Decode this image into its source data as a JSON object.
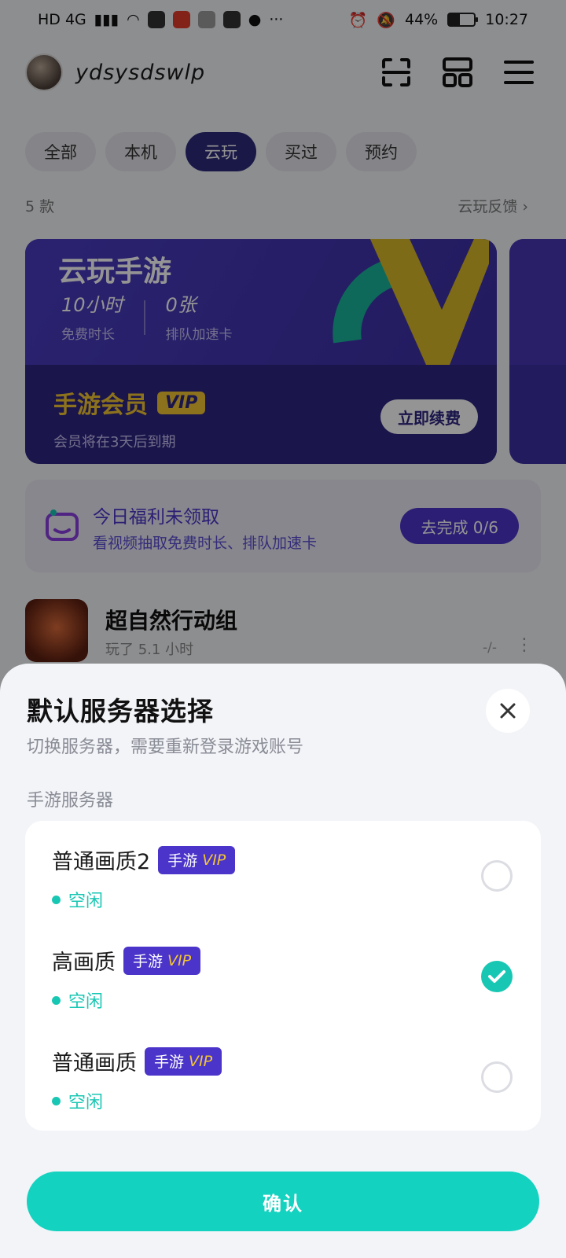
{
  "status_bar": {
    "network": "HD 4G",
    "chips": [
      "游戏大全",
      "微博",
      "QQ",
      "游戏大全"
    ],
    "more": "···",
    "battery": "44%",
    "time": "10:27"
  },
  "header": {
    "username": "ydsysdswlp"
  },
  "tabs": [
    {
      "label": "全部"
    },
    {
      "label": "本机"
    },
    {
      "label": "云玩"
    },
    {
      "label": "买过"
    },
    {
      "label": "预约"
    }
  ],
  "active_tab": "云玩",
  "list_info": {
    "count": "5 款",
    "feedback": "云玩反馈"
  },
  "banner": {
    "title": "云玩手游",
    "stat1_value": "10小时",
    "stat1_label": "免费时长",
    "stat2_value": "0张",
    "stat2_label": "排队加速卡",
    "vip_title": "手游会员",
    "vip_tag": "VIP",
    "vip_sub": "会员将在3天后到期",
    "renew_button": "立即续费"
  },
  "welfare": {
    "title": "今日福利未领取",
    "subtitle": "看视频抽取免费时长、排队加速卡",
    "button": "去完成 0/6"
  },
  "game": {
    "name": "超自然行动组",
    "played": "玩了 5.1 小时",
    "meta": "-/-"
  },
  "sheet": {
    "title": "默认服务器选择",
    "subtitle": "切换服务器，需要重新登录游戏账号",
    "section_label": "手游服务器",
    "servers": [
      {
        "name": "普通画质2",
        "badge_a": "手游",
        "badge_b": "VIP",
        "status": "空闲",
        "selected": false
      },
      {
        "name": "高画质",
        "badge_a": "手游",
        "badge_b": "VIP",
        "status": "空闲",
        "selected": true
      },
      {
        "name": "普通画质",
        "badge_a": "手游",
        "badge_b": "VIP",
        "status": "空闲",
        "selected": false
      }
    ],
    "confirm_button": "确认"
  },
  "colors": {
    "accent_teal": "#14d2c0",
    "status_teal": "#18c7b3",
    "vip_purple": "#4a34c9",
    "vip_gold": "#f3c532",
    "tab_active": "#2d2a7b"
  },
  "icons": {
    "close": "close-icon",
    "check": "check-icon",
    "scan": "scan-icon",
    "grid": "grid-icon",
    "menu": "menu-icon"
  }
}
